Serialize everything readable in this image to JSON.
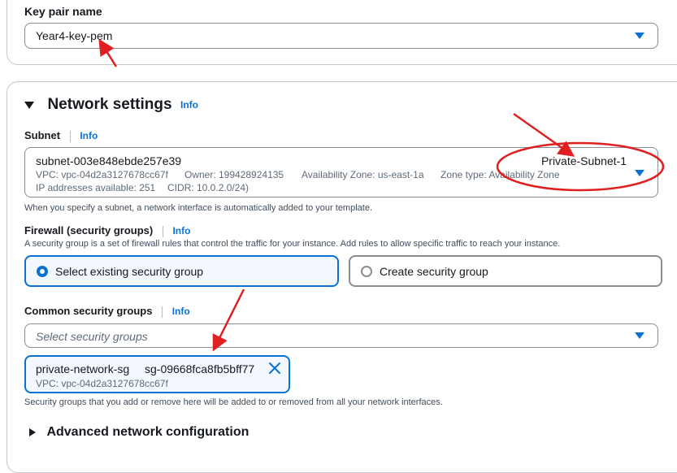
{
  "key_pair": {
    "label": "Key pair name",
    "value": "Year4-key-pem"
  },
  "network": {
    "title": "Network settings",
    "info": "Info",
    "subnet": {
      "label": "Subnet",
      "info": "Info",
      "id": "subnet-003e848ebde257e39",
      "name": "Private-Subnet-1",
      "vpc": "VPC: vpc-04d2a3127678cc67f",
      "owner": "Owner: 199428924135",
      "az": "Availability Zone: us-east-1a",
      "zone_type": "Zone type: Availability Zone",
      "ips": "IP addresses available: 251",
      "cidr": "CIDR: 10.0.2.0/24)",
      "hint": "When you specify a subnet, a network interface is automatically added to your template."
    },
    "firewall": {
      "label": "Firewall (security groups)",
      "info": "Info",
      "desc": "A security group is a set of firewall rules that control the traffic for your instance. Add rules to allow specific traffic to reach your instance.",
      "option_existing": "Select existing security group",
      "option_create": "Create security group",
      "selected": "existing"
    },
    "common_sg": {
      "label": "Common security groups",
      "info": "Info",
      "placeholder": "Select security groups",
      "token_name": "private-network-sg",
      "token_id": "sg-09668fca8fb5bff77",
      "token_vpc": "VPC: vpc-04d2a3127678cc67f",
      "hint": "Security groups that you add or remove here will be added to or removed from all your network interfaces."
    },
    "advanced": "Advanced network configuration"
  },
  "colors": {
    "accent": "#0972d3",
    "annotation": "#e02020",
    "border": "#8c8c94"
  },
  "icons": {
    "dropdown": "caret-down-icon",
    "expand": "triangle-right-icon",
    "collapse": "triangle-down-icon",
    "remove": "close-icon"
  }
}
